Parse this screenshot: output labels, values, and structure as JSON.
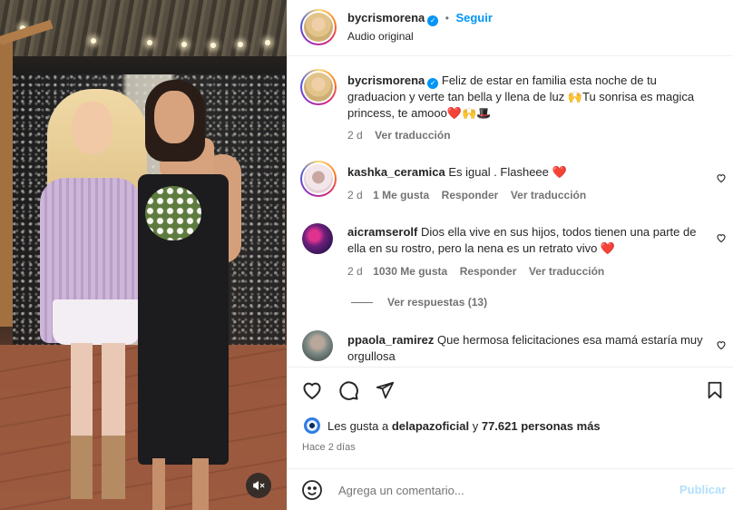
{
  "post": {
    "media": {
      "alt_scene": "photo",
      "mute_icon": "volume-off-icon"
    }
  },
  "header": {
    "username": "bycrismorena",
    "verified": true,
    "separator": "•",
    "follow_label": "Seguir",
    "audio_label": "Audio original"
  },
  "caption": {
    "username": "bycrismorena",
    "text": "Feliz de estar en familia esta noche de tu graduacion y verte tan bella y llena de luz 🙌Tu sonrisa es magica princess, te amooo❤️🙌🎩",
    "time": "2 d",
    "translate_label": "Ver traducción"
  },
  "comments": [
    {
      "username": "kashka_ceramica",
      "text": "Es igual . Flasheee ❤️",
      "time": "2 d",
      "likes": "1 Me gusta",
      "reply_label": "Responder",
      "translate_label": "Ver traducción"
    },
    {
      "username": "aicramserolf",
      "text": "Dios ella vive en sus hijos, todos tienen una parte de ella en su rostro, pero la nena es un retrato vivo ❤️",
      "time": "2 d",
      "likes": "1030 Me gusta",
      "reply_label": "Responder",
      "translate_label": "Ver traducción",
      "replies_label": "Ver respuestas (13)"
    },
    {
      "username": "ppaola_ramirez",
      "text": "Que hermosa felicitaciones esa mamá estaría muy orgullosa"
    }
  ],
  "actions": {
    "like_icon": "heart-icon",
    "comment_icon": "comment-icon",
    "share_icon": "send-icon",
    "save_icon": "bookmark-icon"
  },
  "likes_summary": {
    "prefix": "Les gusta a",
    "user": "delapazoficial",
    "connector": "y",
    "others": "77.621 personas más"
  },
  "posted_ago": "Hace 2 días",
  "add_comment": {
    "placeholder": "Agrega un comentario...",
    "post_label": "Publicar",
    "emoji_icon": "emoji-icon"
  },
  "colors": {
    "accent": "#0095f6",
    "text": "#262626",
    "muted": "#737373",
    "border": "#efefef",
    "heart_red": "#ed4956"
  }
}
